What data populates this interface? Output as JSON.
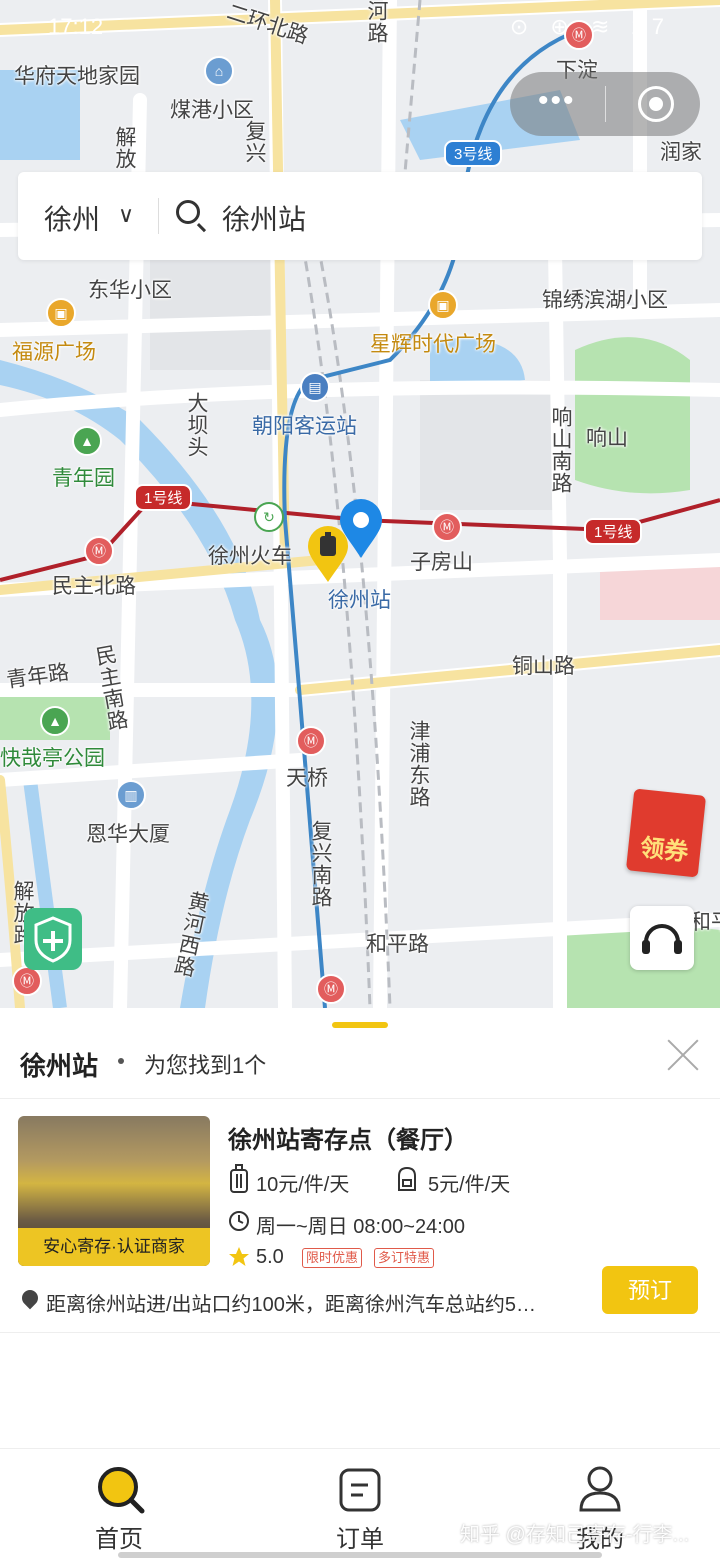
{
  "status_bar": {
    "time": "17:12",
    "icons": "⊙ ⊕ ≋ 27"
  },
  "map": {
    "labels": {
      "l1": "华府天地家园",
      "l2": "煤港小区",
      "l3": "二环北路",
      "l4": "下淀",
      "l5": "润家",
      "l6": "东华小区",
      "l7": "锦绣滨湖小区",
      "l8": "福源广场",
      "l9": "星辉时代广场",
      "l10": "朝阳客运站",
      "l11": "响山",
      "l12": "青年园",
      "l13": "徐州火车",
      "l14": "子房山",
      "l15": "徐州站",
      "l16": "民主北路",
      "l17": "青年路",
      "l18": "铜山路",
      "l19": "快哉亭公园",
      "l20": "天桥",
      "l21": "恩华大厦",
      "l22": "和平路",
      "l23": "大坝头",
      "l24": "响山南路",
      "l25": "民主南路",
      "l26": "津浦东路",
      "l27": "复兴南路",
      "l28": "黄河西路",
      "l29": "解放",
      "l30": "复兴",
      "l31": "河路",
      "l32": "和平",
      "l33": "解放路"
    },
    "lines": {
      "line1": "1号线",
      "line1b": "1号线",
      "line3": "3号线",
      "line1c": "1号线"
    },
    "colors": {
      "metro1": "#b0202a",
      "metro3": "#3d86c6",
      "river": "#a9d2f2",
      "park": "#b6e3b0"
    }
  },
  "header": {
    "city": "徐州",
    "search_query": "徐州站"
  },
  "floating": {
    "coupon": "领券"
  },
  "sheet": {
    "title": "徐州站",
    "found_text": "为您找到1个",
    "store": {
      "badge": "安心寄存·认证商家",
      "name": "徐州站寄存点（餐厅）",
      "price_large": "10元/件/天",
      "price_small": "5元/件/天",
      "hours": "周一~周日 08:00~24:00",
      "rating": "5.0",
      "tag1": "限时优惠",
      "tag2": "多订特惠",
      "address": "距离徐州站进/出站口约100米，距离徐州汽车总站约5…",
      "book": "预订"
    }
  },
  "tabs": {
    "home": "首页",
    "orders": "订单",
    "mine": "我的"
  },
  "watermark": "知乎 @存知己寄存-行李..."
}
